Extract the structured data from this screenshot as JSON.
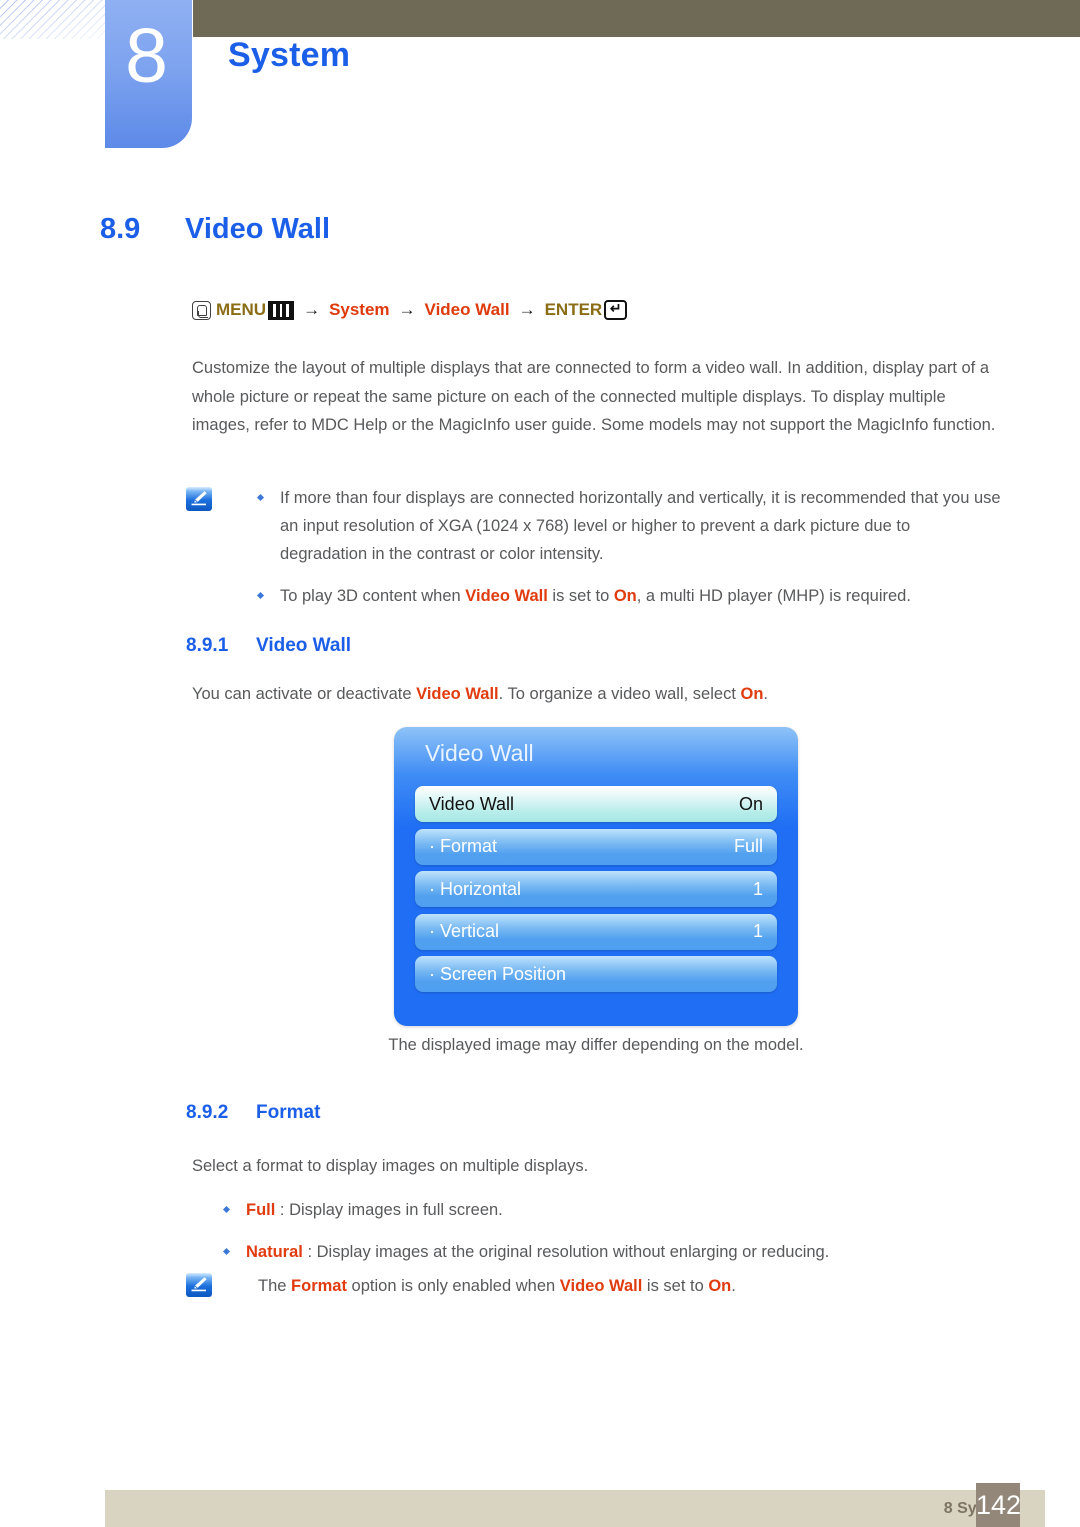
{
  "header": {
    "chapter_number": "8",
    "chapter_title": "System",
    "accent_blue": "#1b5fe8",
    "bar_color": "#6e6a55"
  },
  "section": {
    "number": "8.9",
    "title": "Video Wall"
  },
  "breadcrumb": {
    "menu_icon": "menu-hand-icon",
    "menu_label": "MENU",
    "bars_icon": "menu-bars-icon",
    "arrow": "→",
    "step1": "System",
    "step2": "Video Wall",
    "enter_label": "ENTER",
    "enter_icon": "enter-return-icon",
    "enter_glyph": "↵"
  },
  "intro": {
    "text": "Customize the layout of multiple displays that are connected to form a video wall. In addition, display part of a whole picture or repeat the same picture on each of the connected multiple displays. To display multiple images, refer to MDC Help or the MagicInfo user guide. Some models may not support the MagicInfo function."
  },
  "note_a": {
    "icon": "note-pencil-icon",
    "items": [
      {
        "text": "If more than four displays are connected horizontally and vertically, it is recommended that you use an input resolution of XGA (1024 x 768) level or higher to prevent a dark picture due to degradation in the contrast or color intensity."
      },
      {
        "pre": "To play 3D content when ",
        "em1": "Video Wall",
        "mid": " is set to ",
        "em2": "On",
        "post": ", a multi HD player (MHP) is required."
      }
    ]
  },
  "sub1": {
    "number": "8.9.1",
    "title": "Video Wall",
    "lead_pre": "You can activate or deactivate ",
    "lead_em1": "Video Wall",
    "lead_mid": ". To organize a video wall, select ",
    "lead_em2": "On",
    "lead_post": "."
  },
  "osd": {
    "title": "Video Wall",
    "rows": [
      {
        "label": "Video Wall",
        "value": "On",
        "selected": true
      },
      {
        "label": "· Format",
        "value": "Full",
        "selected": false
      },
      {
        "label": "· Horizontal",
        "value": "1",
        "selected": false
      },
      {
        "label": "· Vertical",
        "value": "1",
        "selected": false
      },
      {
        "label": "· Screen Position",
        "value": "",
        "selected": false
      }
    ],
    "caption": "The displayed image may differ depending on the model."
  },
  "sub2": {
    "number": "8.9.2",
    "title": "Format",
    "lead": "Select a format to display images on multiple displays.",
    "options": [
      {
        "em": "Full",
        "text": " : Display images in full screen."
      },
      {
        "em": "Natural",
        "text": " : Display images at the original resolution without enlarging or reducing."
      }
    ]
  },
  "note_b": {
    "icon": "note-pencil-icon",
    "pre": "The ",
    "em1": "Format",
    "mid": " option is only enabled when ",
    "em2": "Video Wall",
    "mid2": " is set to ",
    "em3": "On",
    "post": "."
  },
  "footer": {
    "label": "8 System",
    "page": "142",
    "bar_color": "#d9d4c1",
    "page_box_color": "#938779"
  }
}
